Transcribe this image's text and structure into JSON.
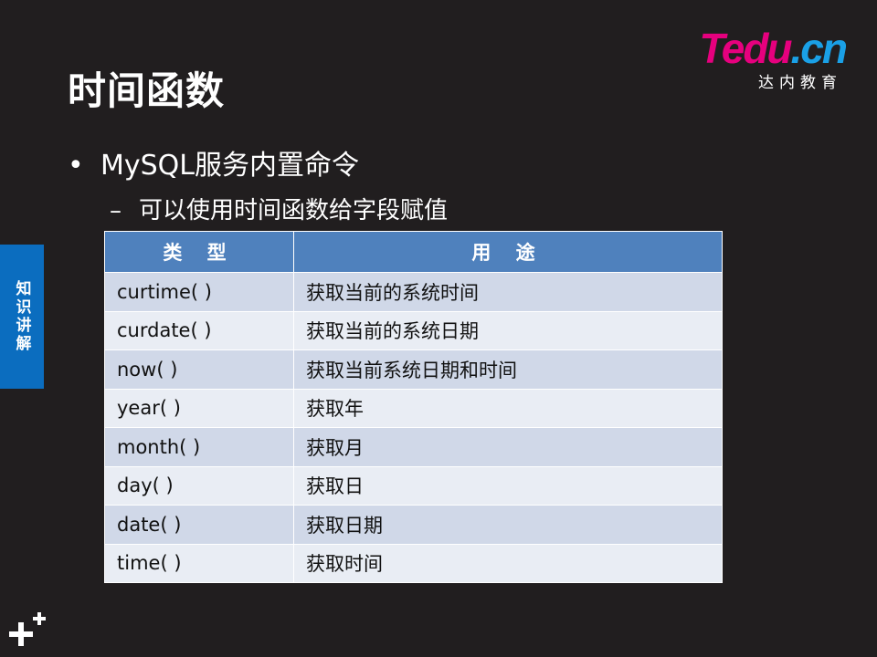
{
  "logo": {
    "main_part1": "Tedu",
    "main_part2": ".cn",
    "sub": "达内教育"
  },
  "title": "时间函数",
  "bullets": {
    "level1": "MySQL服务内置命令",
    "level2": "可以使用时间函数给字段赋值"
  },
  "side_tab": "知识讲解",
  "table": {
    "headers": [
      "类 型",
      "用 途"
    ],
    "rows": [
      [
        "curtime( )",
        "获取当前的系统时间"
      ],
      [
        "curdate( )",
        "获取当前的系统日期"
      ],
      [
        "now( )",
        "获取当前系统日期和时间"
      ],
      [
        "year( )",
        "获取年"
      ],
      [
        "month( )",
        "获取月"
      ],
      [
        "day( )",
        "获取日"
      ],
      [
        "date( )",
        "获取日期"
      ],
      [
        "time( )",
        "获取时间"
      ]
    ]
  },
  "colors": {
    "background": "#211e1f",
    "header_fill": "#4f81bd",
    "row_odd": "#d0d8e8",
    "row_even": "#e9edf4",
    "side_tab": "#0b6dbf",
    "logo_pink": "#e6007e",
    "logo_blue": "#1aa0e6"
  },
  "icons": {
    "corner": "plus-icon"
  }
}
